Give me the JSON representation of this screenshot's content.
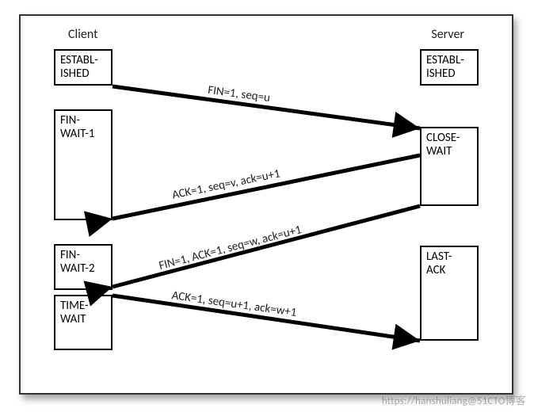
{
  "headers": {
    "client": "Client",
    "server": "Server"
  },
  "client_states": {
    "established": "ESTABL-\nISHED",
    "fin_wait_1": "FIN-\nWAIT-1",
    "fin_wait_2": "FIN-\nWAIT-2",
    "time_wait": "TIME-\nWAIT"
  },
  "server_states": {
    "established": "ESTABL-\nISHED",
    "close_wait": "CLOSE-\nWAIT",
    "last_ack": "LAST-\nACK"
  },
  "messages": {
    "fin1": "FIN=1, seq=u",
    "ack1": "ACK=1, seq=v, ack=u+1",
    "fin2": "FIN=1, ACK=1, seq=w, ack=u+1",
    "ack2": "ACK=1, seq=u+1, ack=w+1"
  },
  "watermark": "https://hanshuliang@51CTO博客",
  "chart_data": {
    "type": "sequence-diagram",
    "title": "TCP Four-Way Connection Termination",
    "participants": [
      "Client",
      "Server"
    ],
    "client_state_transitions": [
      "ESTABLISHED",
      "FIN-WAIT-1",
      "FIN-WAIT-2",
      "TIME-WAIT"
    ],
    "server_state_transitions": [
      "ESTABLISHED",
      "CLOSE-WAIT",
      "LAST-ACK"
    ],
    "messages": [
      {
        "from": "Client",
        "to": "Server",
        "label": "FIN=1, seq=u",
        "client_state_before": "ESTABLISHED",
        "client_state_after": "FIN-WAIT-1",
        "server_state_before": "ESTABLISHED",
        "server_state_after": "CLOSE-WAIT"
      },
      {
        "from": "Server",
        "to": "Client",
        "label": "ACK=1, seq=v, ack=u+1",
        "client_state_after": "FIN-WAIT-2"
      },
      {
        "from": "Server",
        "to": "Client",
        "label": "FIN=1, ACK=1, seq=w, ack=u+1",
        "server_state_before": "CLOSE-WAIT",
        "server_state_after": "LAST-ACK"
      },
      {
        "from": "Client",
        "to": "Server",
        "label": "ACK=1, seq=u+1, ack=w+1",
        "client_state_before": "FIN-WAIT-2",
        "client_state_after": "TIME-WAIT"
      }
    ]
  }
}
